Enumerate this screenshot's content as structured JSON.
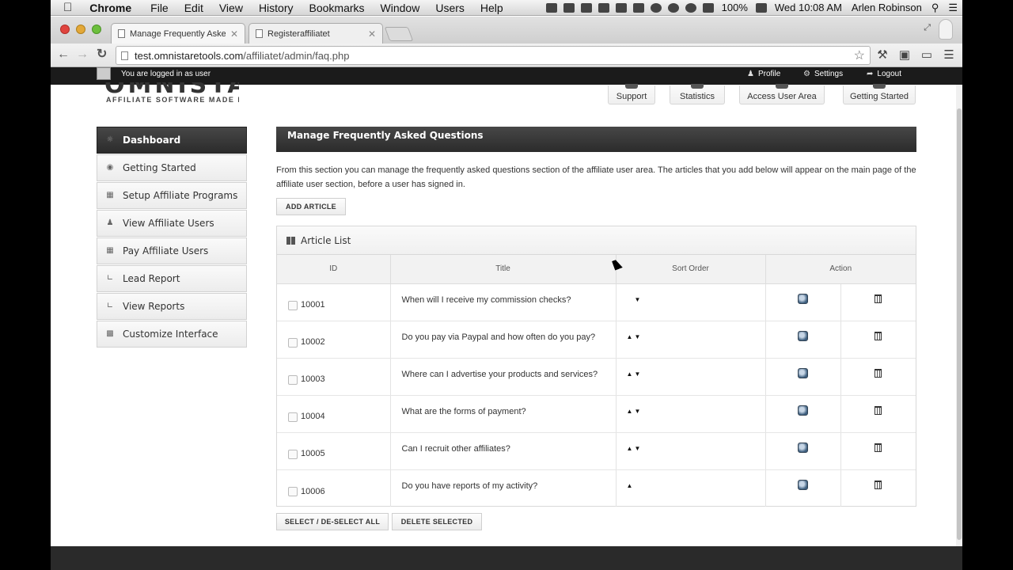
{
  "menubar": {
    "app": "Chrome",
    "items": [
      "File",
      "Edit",
      "View",
      "History",
      "Bookmarks",
      "Window",
      "Users",
      "Help"
    ],
    "battery": "100%",
    "clock": "Wed 10:08 AM",
    "user": "Arlen Robinson"
  },
  "tabs": [
    {
      "label": "Manage Frequently Asked"
    },
    {
      "label": "Registeraffiliatet"
    }
  ],
  "toolbar": {
    "url_host": "test.omnistaretools.com",
    "url_path": "/affiliatet/admin/faq.php"
  },
  "sitebar": {
    "login_text": "You are logged in as user",
    "links": [
      "Profile",
      "Settings",
      "Logout"
    ]
  },
  "header": {
    "logo_text": "OMNISTAR",
    "tagline": "AFFILIATE SOFTWARE MADE EASY",
    "buttons": [
      "Support",
      "Statistics",
      "Access User Area",
      "Getting Started"
    ]
  },
  "sidebar": {
    "items": [
      {
        "label": "Dashboard",
        "icon": "dashboard-icon"
      },
      {
        "label": "Getting Started",
        "icon": "eye-icon"
      },
      {
        "label": "Setup Affiliate Programs",
        "icon": "grid-icon"
      },
      {
        "label": "View Affiliate Users",
        "icon": "users-icon"
      },
      {
        "label": "Pay Affiliate Users",
        "icon": "calendar-icon"
      },
      {
        "label": "Lead Report",
        "icon": "chart-icon"
      },
      {
        "label": "View Reports",
        "icon": "chart-icon"
      },
      {
        "label": "Customize Interface",
        "icon": "customize-icon"
      }
    ]
  },
  "main": {
    "title": "Manage Frequently Asked Questions",
    "intro": "From this section you can manage the frequently asked questions section of the affiliate user area. The articles that you add below will appear on the main page of the affiliate user section, before a user has signed in.",
    "add_button": "ADD ARTICLE",
    "list_title": "Article List",
    "columns": [
      "ID",
      "Title",
      "Sort Order",
      "Action"
    ],
    "rows": [
      {
        "id": "10001",
        "title": "When will I receive my commission checks?",
        "sort": "down"
      },
      {
        "id": "10002",
        "title": "Do you pay via Paypal and how often do you pay?",
        "sort": "both"
      },
      {
        "id": "10003",
        "title": "Where can I advertise your products and services?",
        "sort": "both"
      },
      {
        "id": "10004",
        "title": "What are the forms of payment?",
        "sort": "both"
      },
      {
        "id": "10005",
        "title": "Can I recruit other affiliates?",
        "sort": "both"
      },
      {
        "id": "10006",
        "title": "Do you have reports of my activity?",
        "sort": "up"
      }
    ],
    "select_all_button": "SELECT / DE-SELECT ALL",
    "delete_selected_button": "DELETE SELECTED"
  }
}
